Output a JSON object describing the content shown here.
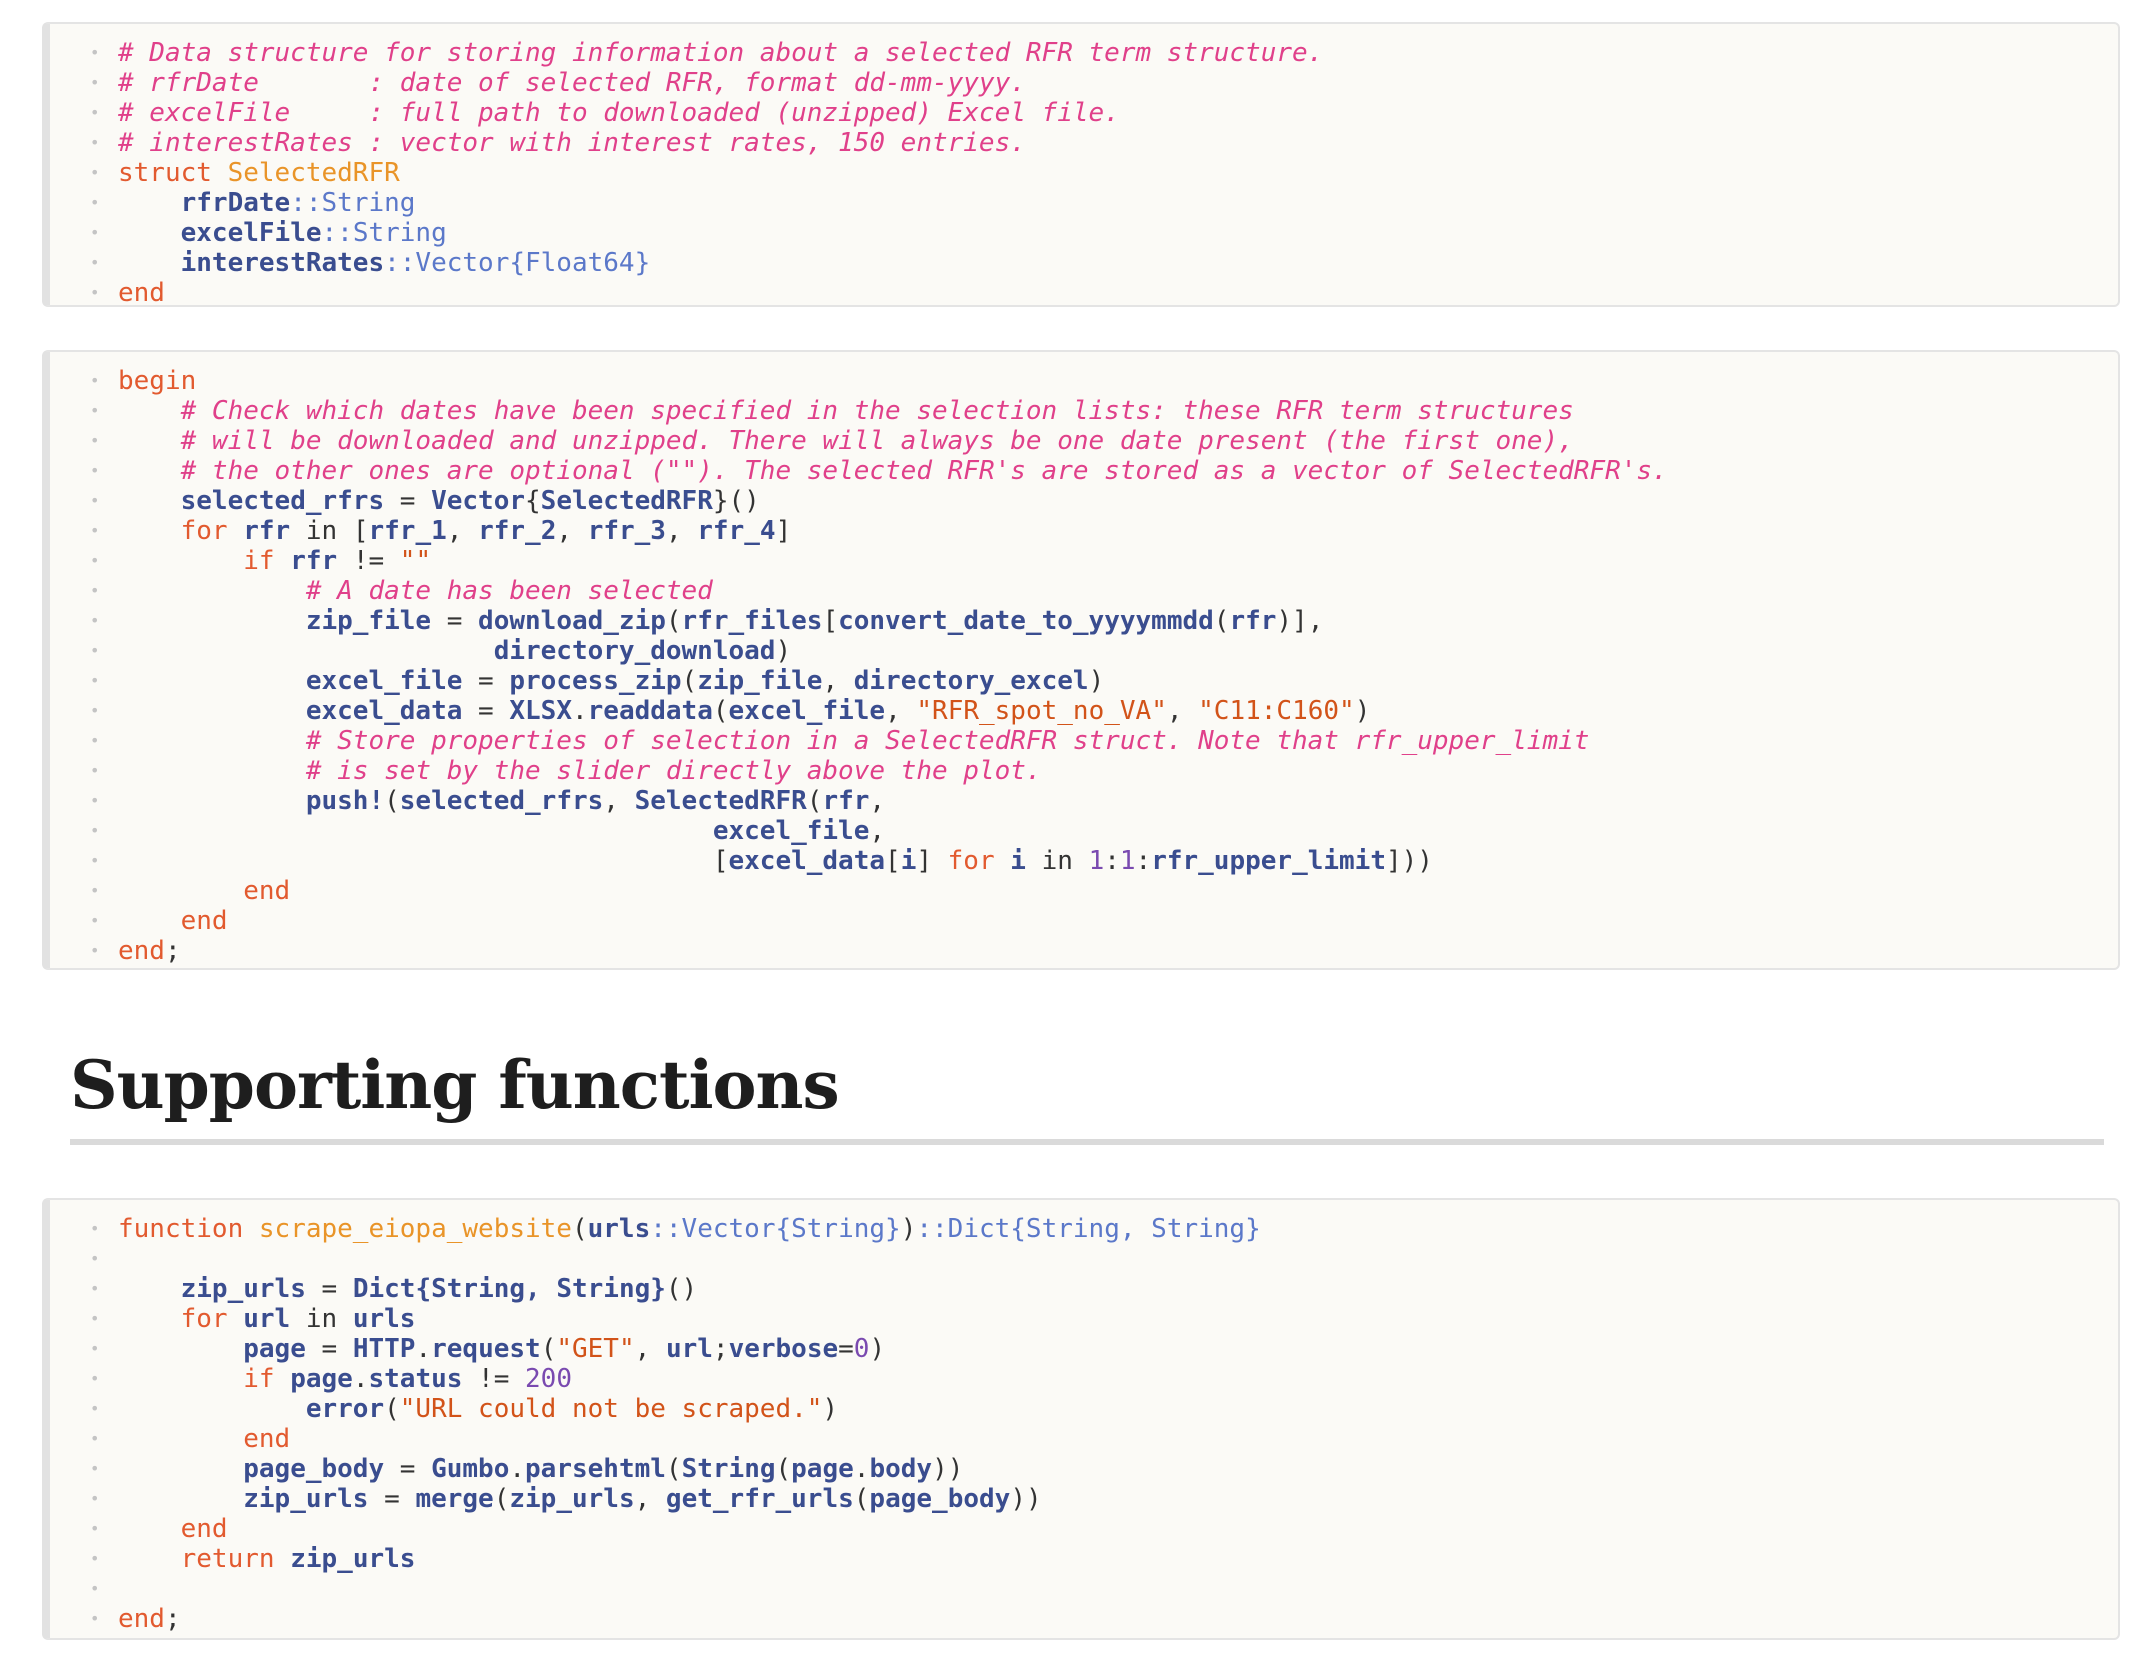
{
  "cell1": {
    "c1": "# Data structure for storing information about a selected RFR term structure.",
    "c2": "# rfrDate       : date of selected RFR, format dd-mm-yyyy.",
    "c3": "# excelFile     : full path to downloaded (unzipped) Excel file.",
    "c4": "# interestRates : vector with interest rates, 150 entries.",
    "kw_struct": "struct",
    "struct_name": "SelectedRFR",
    "f1_name": "rfrDate",
    "f1_type": "::String",
    "f2_name": "excelFile",
    "f2_type": "::String",
    "f3_name": "interestRates",
    "f3_type": "::Vector{Float64}",
    "kw_end": "end"
  },
  "cell2": {
    "kw_begin": "begin",
    "c1": "# Check which dates have been specified in the selection lists: these RFR term structures",
    "c2": "# will be downloaded and unzipped. There will always be one date present (the first one),",
    "c3": "# the other ones are optional (\"\"). The selected RFR's are stored as a vector of SelectedRFR's.",
    "sel_rfrs": "selected_rfrs",
    "eq": " = ",
    "vec_sel": "Vector",
    "lb": "{",
    "sel_type": "SelectedRFR",
    "rb_paren": "}()",
    "kw_for": "for",
    "rfr": "rfr",
    "kw_in": " in ",
    "lbr": "[",
    "r1": "rfr_1",
    "comma": ", ",
    "r2": "rfr_2",
    "r3": "rfr_3",
    "r4": "rfr_4",
    "rbr": "]",
    "kw_if": "if",
    "neq": " != ",
    "empty_str": "\"\"",
    "c4": "# A date has been selected",
    "zip_file": "zip_file",
    "dl_zip": "download_zip",
    "lp": "(",
    "rfr_files": "rfr_files",
    "conv_date": "convert_date_to_yyyymmdd",
    "close1": ")],",
    "dir_dl": "directory_download",
    "rp": ")",
    "excel_file": "excel_file",
    "proc_zip": "process_zip",
    "dir_excel": "directory_excel",
    "excel_data": "excel_data",
    "xlsx": "XLSX",
    "dot": ".",
    "readdata": "readdata",
    "s_sheet": "\"RFR_spot_no_VA\"",
    "s_range": "\"C11:C160\"",
    "c5": "# Store properties of selection in a SelectedRFR struct. Note that rfr_upper_limit",
    "c6": "# is set by the slider directly above the plot.",
    "push": "push!",
    "sel_fn": "SelectedRFR",
    "excel_file_comma": "excel_file",
    "trail_comma": ",",
    "ed_idx_open": "[",
    "i": "i",
    "idx_close": "]",
    "kw_for2": " for ",
    "kw_in2": " in ",
    "one": "1",
    "colon": ":",
    "upper": "rfr_upper_limit",
    "close_end": "]))",
    "kw_end": "end",
    "semi": ";"
  },
  "section": {
    "heading": "Supporting functions"
  },
  "cell3": {
    "kw_function": "function",
    "fn_name": "scrape_eiopa_website",
    "lp": "(",
    "urls": "urls",
    "urls_type": "::Vector{String}",
    "rp": ")",
    "ret_type": "::Dict{String, String}",
    "zip_urls": "zip_urls",
    "eq": " = ",
    "dict": "Dict",
    "dict_type": "{String, String}",
    "call_empty": "()",
    "kw_for": "for",
    "url": "url",
    "kw_in": " in ",
    "page": "page",
    "http": "HTTP",
    "dot": ".",
    "request": "request",
    "s_get": "\"GET\"",
    "comma": ", ",
    "semicolon": ";",
    "verbose": "verbose",
    "assign": "=",
    "zero": "0",
    "kw_if": "if",
    "status": "status",
    "neq": " != ",
    "n200": "200",
    "error": "error",
    "s_err": "\"URL could not be scraped.\"",
    "kw_end": "end",
    "page_body": "page_body",
    "gumbo": "Gumbo",
    "parsehtml": "parsehtml",
    "string_fn": "String",
    "body": "body",
    "close2": "))",
    "merge": "merge",
    "get_rfr_urls": "get_rfr_urls",
    "kw_return": "return",
    "semi": ";"
  },
  "gutter_dot": "•"
}
